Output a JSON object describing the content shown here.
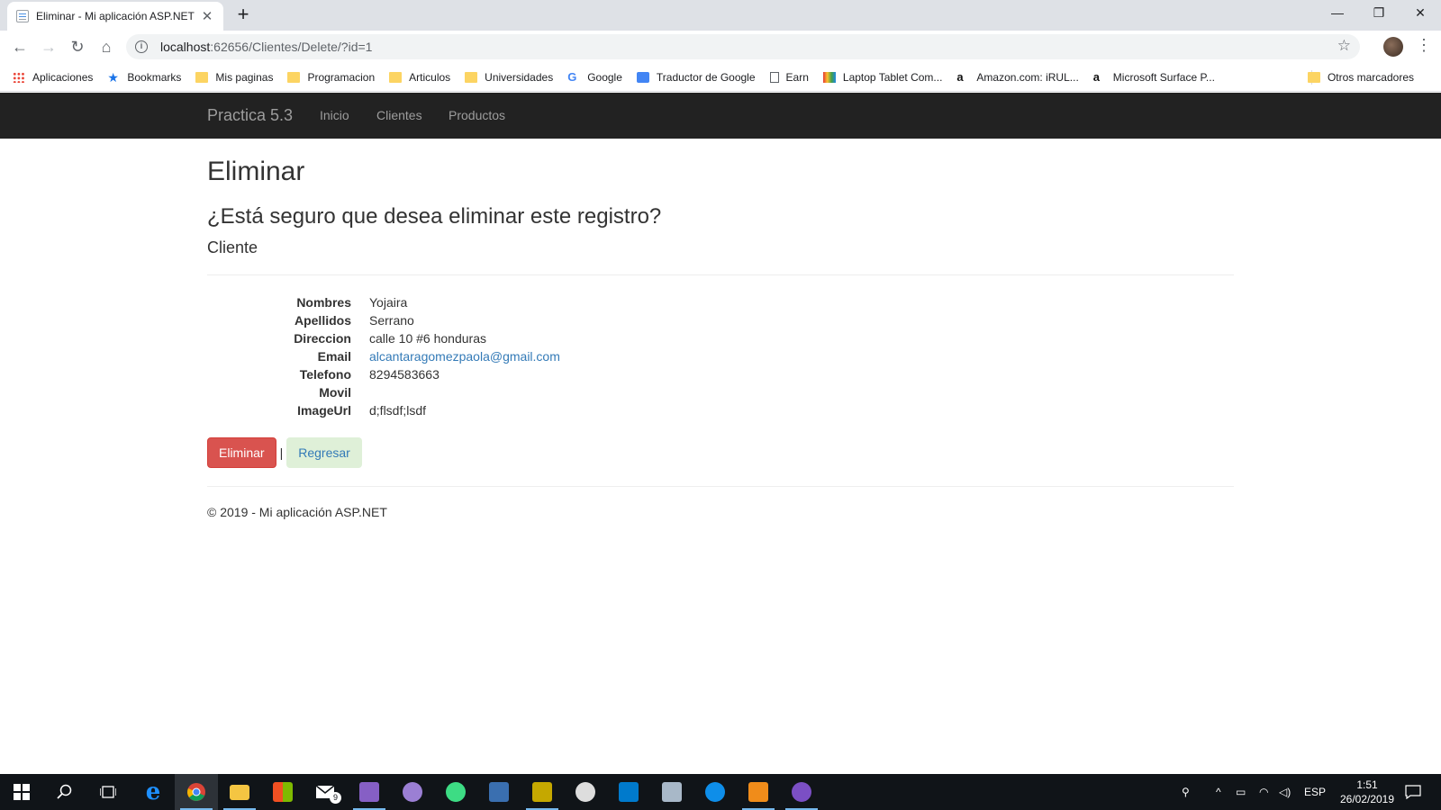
{
  "browser": {
    "tab_title": "Eliminar - Mi aplicación ASP.NET",
    "tab_close": "✕",
    "new_tab": "+",
    "minimize": "—",
    "restore": "❐",
    "close": "✕",
    "url_host": "localhost",
    "url_rest": ":62656/Clientes/Delete/?id=1",
    "bookmarks": [
      {
        "label": "Aplicaciones",
        "icon": "apps-icon"
      },
      {
        "label": "Bookmarks",
        "icon": "star-icon"
      },
      {
        "label": "Mis paginas",
        "icon": "folder-icon"
      },
      {
        "label": "Programacion",
        "icon": "folder-icon"
      },
      {
        "label": "Articulos",
        "icon": "folder-icon"
      },
      {
        "label": "Universidades",
        "icon": "folder-icon"
      },
      {
        "label": "Google",
        "icon": "google-icon"
      },
      {
        "label": "Traductor de Google",
        "icon": "translate-icon"
      },
      {
        "label": "Earn",
        "icon": "page-icon"
      },
      {
        "label": "Laptop Tablet Com...",
        "icon": "laptop-icon"
      },
      {
        "label": "Amazon.com: iRUL...",
        "icon": "amazon-icon"
      },
      {
        "label": "Microsoft Surface P...",
        "icon": "amazon-icon"
      }
    ],
    "other_bookmarks": "Otros marcadores"
  },
  "navbar": {
    "brand": "Practica 5.3",
    "links": [
      "Inicio",
      "Clientes",
      "Productos"
    ]
  },
  "page": {
    "title": "Eliminar",
    "question": "¿Está seguro que desea eliminar este registro?",
    "entity": "Cliente",
    "fields": [
      {
        "label": "Nombres",
        "value": "Yojaira"
      },
      {
        "label": "Apellidos",
        "value": "Serrano"
      },
      {
        "label": "Direccion",
        "value": "calle 10 #6 honduras"
      },
      {
        "label": "Email",
        "value": "alcantaragomezpaola@gmail.com"
      },
      {
        "label": "Telefono",
        "value": "8294583663"
      },
      {
        "label": "Movil",
        "value": ""
      },
      {
        "label": "ImageUrl",
        "value": "d;flsdf;lsdf"
      }
    ],
    "delete_button": "Eliminar",
    "separator": "|",
    "back_button": "Regresar",
    "footer": "© 2019 - Mi aplicación ASP.NET"
  },
  "taskbar": {
    "language": "ESP",
    "time": "1:51",
    "date": "26/02/2019",
    "mail_badge": "9"
  }
}
